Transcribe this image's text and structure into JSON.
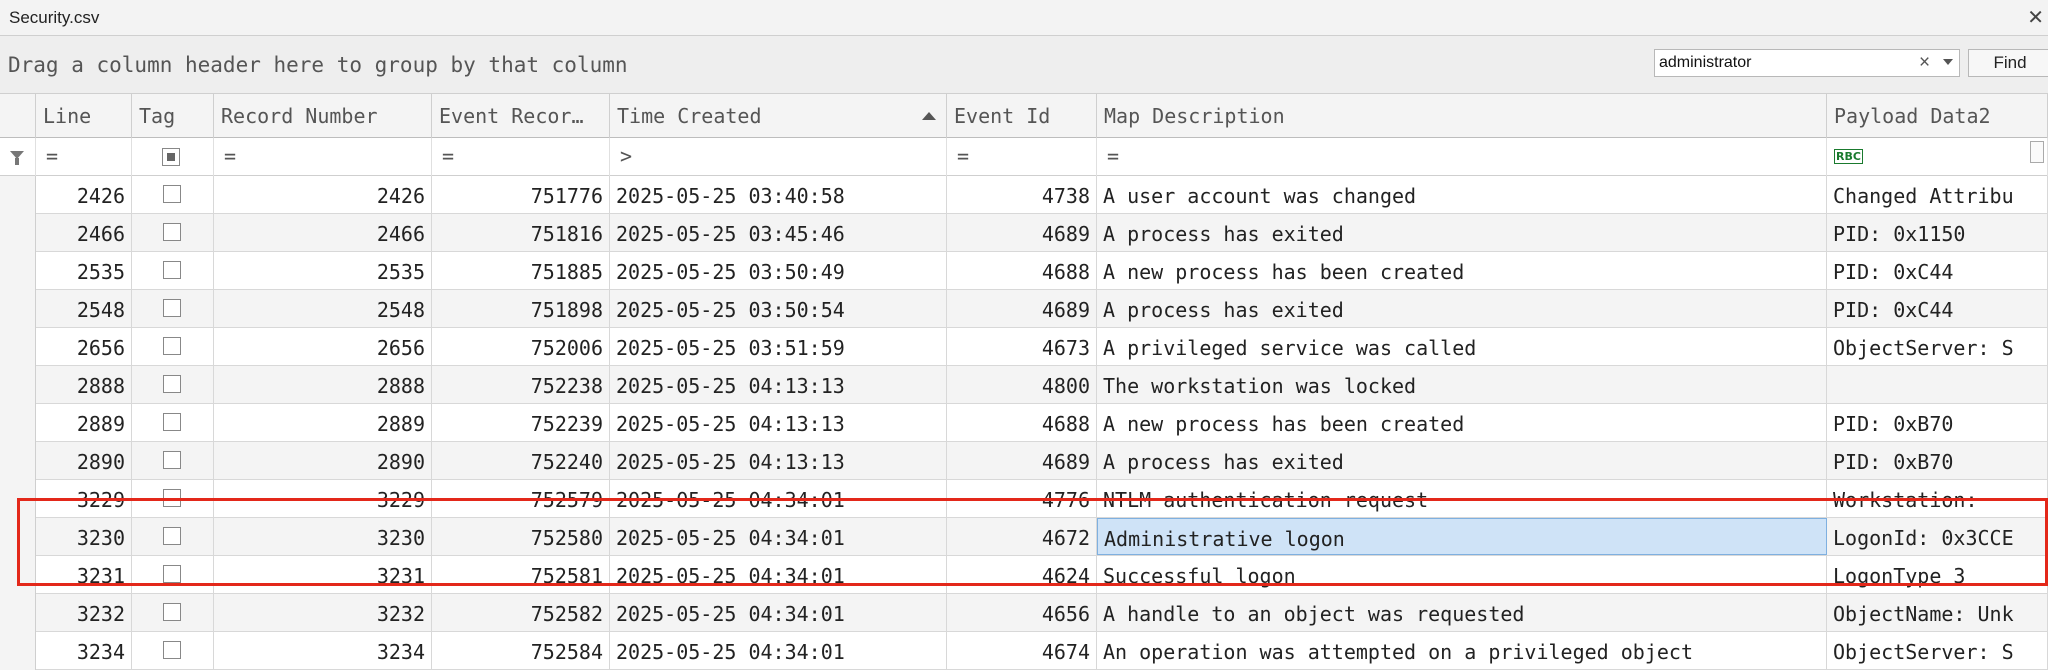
{
  "window": {
    "title": "Security.csv",
    "close_glyph": "✕"
  },
  "groupbar": {
    "hint": "Drag a column header here to group by that column"
  },
  "find": {
    "value": "administrator",
    "clear_glyph": "×",
    "button_label": "Find"
  },
  "columns": {
    "line": "Line",
    "tag": "Tag",
    "record_number": "Record Number",
    "event_record": "Event Recor…",
    "time_created": "Time Created",
    "event_id": "Event Id",
    "map_description": "Map Description",
    "payload_data2": "Payload Data2"
  },
  "sort": {
    "column": "Time Created",
    "direction": "ascending"
  },
  "filters": {
    "line": "=",
    "record_number": "=",
    "event_record": "=",
    "time_created": ">",
    "event_id": "=",
    "map_description": "=",
    "payload_abc": "RBC"
  },
  "rows": [
    {
      "line": "2426",
      "record_number": "2426",
      "event_record": "751776",
      "time_created": "2025-05-25 03:40:58",
      "event_id": "4738",
      "map_description": "A user account was changed",
      "payload_data2": "Changed Attribu"
    },
    {
      "line": "2466",
      "record_number": "2466",
      "event_record": "751816",
      "time_created": "2025-05-25 03:45:46",
      "event_id": "4689",
      "map_description": "A process has exited",
      "payload_data2": "PID: 0x1150"
    },
    {
      "line": "2535",
      "record_number": "2535",
      "event_record": "751885",
      "time_created": "2025-05-25 03:50:49",
      "event_id": "4688",
      "map_description": "A new process has been created",
      "payload_data2": "PID: 0xC44"
    },
    {
      "line": "2548",
      "record_number": "2548",
      "event_record": "751898",
      "time_created": "2025-05-25 03:50:54",
      "event_id": "4689",
      "map_description": "A process has exited",
      "payload_data2": "PID: 0xC44"
    },
    {
      "line": "2656",
      "record_number": "2656",
      "event_record": "752006",
      "time_created": "2025-05-25 03:51:59",
      "event_id": "4673",
      "map_description": "A privileged service was called",
      "payload_data2": "ObjectServer: S"
    },
    {
      "line": "2888",
      "record_number": "2888",
      "event_record": "752238",
      "time_created": "2025-05-25 04:13:13",
      "event_id": "4800",
      "map_description": "The workstation was locked",
      "payload_data2": ""
    },
    {
      "line": "2889",
      "record_number": "2889",
      "event_record": "752239",
      "time_created": "2025-05-25 04:13:13",
      "event_id": "4688",
      "map_description": "A new process has been created",
      "payload_data2": "PID: 0xB70"
    },
    {
      "line": "2890",
      "record_number": "2890",
      "event_record": "752240",
      "time_created": "2025-05-25 04:13:13",
      "event_id": "4689",
      "map_description": "A process has exited",
      "payload_data2": "PID: 0xB70"
    },
    {
      "line": "3229",
      "record_number": "3229",
      "event_record": "752579",
      "time_created": "2025-05-25 04:34:01",
      "event_id": "4776",
      "map_description": "NTLM authentication request",
      "payload_data2": "Workstation:"
    },
    {
      "line": "3230",
      "record_number": "3230",
      "event_record": "752580",
      "time_created": "2025-05-25 04:34:01",
      "event_id": "4672",
      "map_description": "Administrative logon",
      "payload_data2": "LogonId: 0x3CCE"
    },
    {
      "line": "3231",
      "record_number": "3231",
      "event_record": "752581",
      "time_created": "2025-05-25 04:34:01",
      "event_id": "4624",
      "map_description": "Successful logon",
      "payload_data2": "LogonType 3"
    },
    {
      "line": "3232",
      "record_number": "3232",
      "event_record": "752582",
      "time_created": "2025-05-25 04:34:01",
      "event_id": "4656",
      "map_description": "A handle to an object was requested",
      "payload_data2": "ObjectName: Unk"
    },
    {
      "line": "3234",
      "record_number": "3234",
      "event_record": "752584",
      "time_created": "2025-05-25 04:34:01",
      "event_id": "4674",
      "map_description": "An operation was attempted on a privileged object",
      "payload_data2": "ObjectServer: S"
    }
  ],
  "selection": {
    "row_line": "3230",
    "column": "Map Description"
  },
  "colors": {
    "highlight_box": "#e3281a",
    "selected_cell": "#cfe3f7",
    "alt_row": "#f4f4f4"
  }
}
